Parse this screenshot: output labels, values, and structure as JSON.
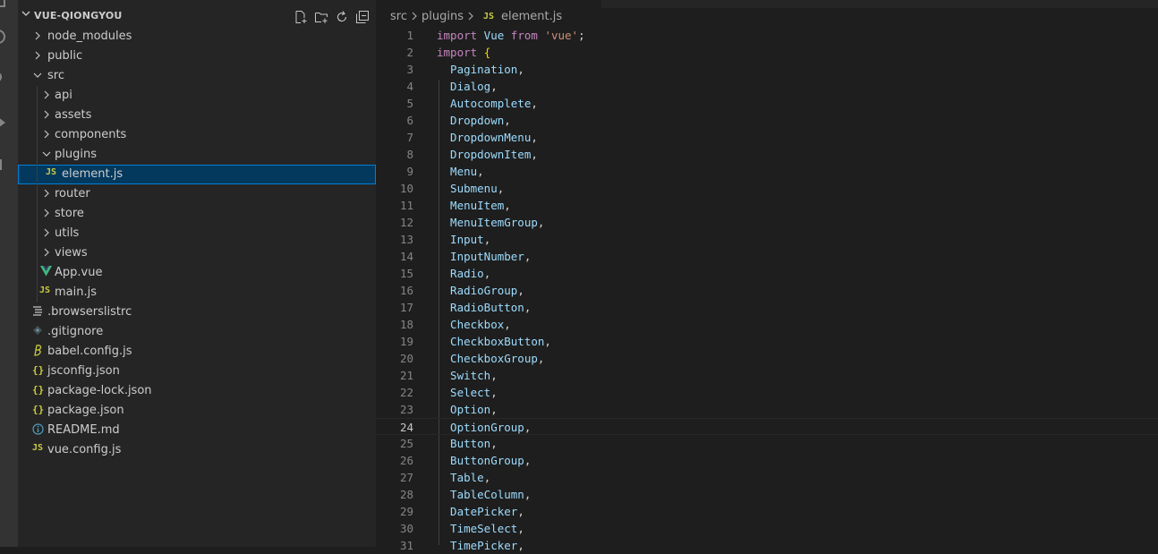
{
  "explorer": {
    "title": "VUE-QIONGYOU",
    "actions": [
      {
        "name": "new-file-icon"
      },
      {
        "name": "new-folder-icon"
      },
      {
        "name": "refresh-icon"
      },
      {
        "name": "collapse-all-icon"
      }
    ],
    "tree": [
      {
        "label": "node_modules",
        "type": "folder",
        "expanded": false,
        "depth": 0
      },
      {
        "label": "public",
        "type": "folder",
        "expanded": false,
        "depth": 0
      },
      {
        "label": "src",
        "type": "folder",
        "expanded": true,
        "depth": 0
      },
      {
        "label": "api",
        "type": "folder",
        "expanded": false,
        "depth": 1
      },
      {
        "label": "assets",
        "type": "folder",
        "expanded": false,
        "depth": 1
      },
      {
        "label": "components",
        "type": "folder",
        "expanded": false,
        "depth": 1
      },
      {
        "label": "plugins",
        "type": "folder",
        "expanded": true,
        "depth": 1
      },
      {
        "label": "element.js",
        "type": "js",
        "icon_text": "JS",
        "depth": 2,
        "selected": true
      },
      {
        "label": "router",
        "type": "folder",
        "expanded": false,
        "depth": 1
      },
      {
        "label": "store",
        "type": "folder",
        "expanded": false,
        "depth": 1
      },
      {
        "label": "utils",
        "type": "folder",
        "expanded": false,
        "depth": 1
      },
      {
        "label": "views",
        "type": "folder",
        "expanded": false,
        "depth": 1
      },
      {
        "label": "App.vue",
        "type": "vue",
        "depth": 1
      },
      {
        "label": "main.js",
        "type": "js",
        "icon_text": "JS",
        "depth": 1
      },
      {
        "label": ".browserslistrc",
        "type": "lines",
        "depth": 0
      },
      {
        "label": ".gitignore",
        "type": "git",
        "depth": 0
      },
      {
        "label": "babel.config.js",
        "type": "babel",
        "depth": 0
      },
      {
        "label": "jsconfig.json",
        "type": "json",
        "icon_text": "{}",
        "depth": 0
      },
      {
        "label": "package-lock.json",
        "type": "json",
        "icon_text": "{}",
        "depth": 0
      },
      {
        "label": "package.json",
        "type": "json",
        "icon_text": "{}",
        "depth": 0
      },
      {
        "label": "README.md",
        "type": "info",
        "depth": 0
      },
      {
        "label": "vue.config.js",
        "type": "js",
        "icon_text": "JS",
        "depth": 0
      }
    ]
  },
  "breadcrumb": {
    "items": [
      "src",
      "plugins",
      "element.js"
    ],
    "file_icon_text": "JS"
  },
  "editor": {
    "current_line": 24,
    "lines": [
      [
        {
          "t": "import",
          "c": "kw"
        },
        {
          "t": " Vue ",
          "c": "ident"
        },
        {
          "t": "from",
          "c": "kw"
        },
        {
          "t": " ",
          "c": "punc"
        },
        {
          "t": "'vue'",
          "c": "str"
        },
        {
          "t": ";",
          "c": "punc"
        }
      ],
      [
        {
          "t": "import",
          "c": "kw"
        },
        {
          "t": " ",
          "c": "punc"
        },
        {
          "t": "{",
          "c": "brace"
        }
      ],
      [
        {
          "t": "  Pagination",
          "c": "ident"
        },
        {
          "t": ",",
          "c": "punc"
        }
      ],
      [
        {
          "t": "  Dialog",
          "c": "ident"
        },
        {
          "t": ",",
          "c": "punc"
        }
      ],
      [
        {
          "t": "  Autocomplete",
          "c": "ident"
        },
        {
          "t": ",",
          "c": "punc"
        }
      ],
      [
        {
          "t": "  Dropdown",
          "c": "ident"
        },
        {
          "t": ",",
          "c": "punc"
        }
      ],
      [
        {
          "t": "  DropdownMenu",
          "c": "ident"
        },
        {
          "t": ",",
          "c": "punc"
        }
      ],
      [
        {
          "t": "  DropdownItem",
          "c": "ident"
        },
        {
          "t": ",",
          "c": "punc"
        }
      ],
      [
        {
          "t": "  Menu",
          "c": "ident"
        },
        {
          "t": ",",
          "c": "punc"
        }
      ],
      [
        {
          "t": "  Submenu",
          "c": "ident"
        },
        {
          "t": ",",
          "c": "punc"
        }
      ],
      [
        {
          "t": "  MenuItem",
          "c": "ident"
        },
        {
          "t": ",",
          "c": "punc"
        }
      ],
      [
        {
          "t": "  MenuItemGroup",
          "c": "ident"
        },
        {
          "t": ",",
          "c": "punc"
        }
      ],
      [
        {
          "t": "  Input",
          "c": "ident"
        },
        {
          "t": ",",
          "c": "punc"
        }
      ],
      [
        {
          "t": "  InputNumber",
          "c": "ident"
        },
        {
          "t": ",",
          "c": "punc"
        }
      ],
      [
        {
          "t": "  Radio",
          "c": "ident"
        },
        {
          "t": ",",
          "c": "punc"
        }
      ],
      [
        {
          "t": "  RadioGroup",
          "c": "ident"
        },
        {
          "t": ",",
          "c": "punc"
        }
      ],
      [
        {
          "t": "  RadioButton",
          "c": "ident"
        },
        {
          "t": ",",
          "c": "punc"
        }
      ],
      [
        {
          "t": "  Checkbox",
          "c": "ident"
        },
        {
          "t": ",",
          "c": "punc"
        }
      ],
      [
        {
          "t": "  CheckboxButton",
          "c": "ident"
        },
        {
          "t": ",",
          "c": "punc"
        }
      ],
      [
        {
          "t": "  CheckboxGroup",
          "c": "ident"
        },
        {
          "t": ",",
          "c": "punc"
        }
      ],
      [
        {
          "t": "  Switch",
          "c": "ident"
        },
        {
          "t": ",",
          "c": "punc"
        }
      ],
      [
        {
          "t": "  Select",
          "c": "ident"
        },
        {
          "t": ",",
          "c": "punc"
        }
      ],
      [
        {
          "t": "  Option",
          "c": "ident"
        },
        {
          "t": ",",
          "c": "punc"
        }
      ],
      [
        {
          "t": "  OptionGroup",
          "c": "ident"
        },
        {
          "t": ",",
          "c": "punc"
        }
      ],
      [
        {
          "t": "  Button",
          "c": "ident"
        },
        {
          "t": ",",
          "c": "punc"
        }
      ],
      [
        {
          "t": "  ButtonGroup",
          "c": "ident"
        },
        {
          "t": ",",
          "c": "punc"
        }
      ],
      [
        {
          "t": "  Table",
          "c": "ident"
        },
        {
          "t": ",",
          "c": "punc"
        }
      ],
      [
        {
          "t": "  TableColumn",
          "c": "ident"
        },
        {
          "t": ",",
          "c": "punc"
        }
      ],
      [
        {
          "t": "  DatePicker",
          "c": "ident"
        },
        {
          "t": ",",
          "c": "punc"
        }
      ],
      [
        {
          "t": "  TimeSelect",
          "c": "ident"
        },
        {
          "t": ",",
          "c": "punc"
        }
      ],
      [
        {
          "t": "  TimePicker",
          "c": "ident"
        },
        {
          "t": ",",
          "c": "punc"
        }
      ]
    ]
  },
  "colors": {
    "sidebar_bg": "#252526",
    "editor_bg": "#1e1e1e",
    "selection_bg": "#04395e",
    "selection_border": "#007fd4",
    "js_icon": "#cbcb41",
    "json_icon": "#cbcb41",
    "vue_icon": "#41b883",
    "info_icon": "#519aba",
    "keyword": "#c586c0",
    "identifier": "#9cdcfe",
    "string": "#ce9178"
  }
}
